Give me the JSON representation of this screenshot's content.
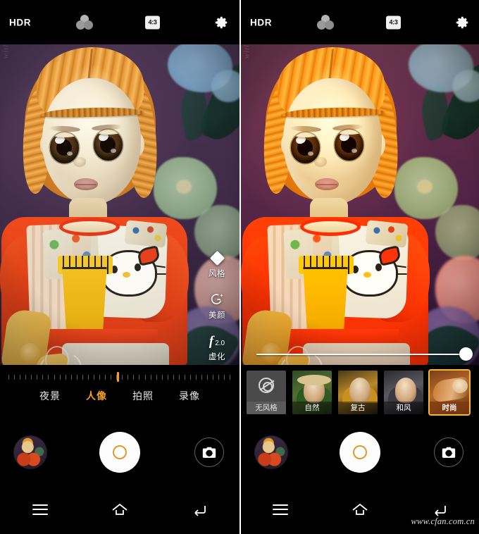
{
  "top_bar": {
    "hdr_label": "HDR",
    "filter_icon": "color-filter-icon",
    "ratio_label": "4:3",
    "settings_icon": "gear-icon"
  },
  "left_panel": {
    "tools": [
      {
        "icon": "style-diamond-icon",
        "label": "风格"
      },
      {
        "icon": "beauty-face-icon",
        "label": "美颜"
      },
      {
        "icon": "aperture-f-icon",
        "value": "2.0",
        "label": "虚化"
      }
    ],
    "modes": [
      {
        "label": "夜景",
        "active": false
      },
      {
        "label": "人像",
        "active": true
      },
      {
        "label": "拍照",
        "active": false
      },
      {
        "label": "录像",
        "active": false
      }
    ]
  },
  "right_panel": {
    "slider": {
      "name": "blur-intensity-slider",
      "value": 96
    },
    "filters": [
      {
        "label": "无风格",
        "selected": false,
        "icon": "no-style-icon"
      },
      {
        "label": "自然",
        "selected": false
      },
      {
        "label": "复古",
        "selected": false
      },
      {
        "label": "和风",
        "selected": false
      },
      {
        "label": "时尚",
        "selected": true
      }
    ]
  },
  "capture": {
    "gallery_label": "gallery-thumbnail",
    "shutter_label": "shutter-button",
    "switch_label": "switch-camera-button"
  },
  "navbar": {
    "menu_label": "menu-button",
    "home_label": "home-button",
    "back_label": "back-button"
  },
  "watermark": {
    "text": "www.cfan.com.cn"
  },
  "scene": {
    "scribble_text": "with love"
  },
  "colors": {
    "accent": "#f2a01d",
    "selected_border": "#f3b63f",
    "bar_background": "#000000"
  }
}
